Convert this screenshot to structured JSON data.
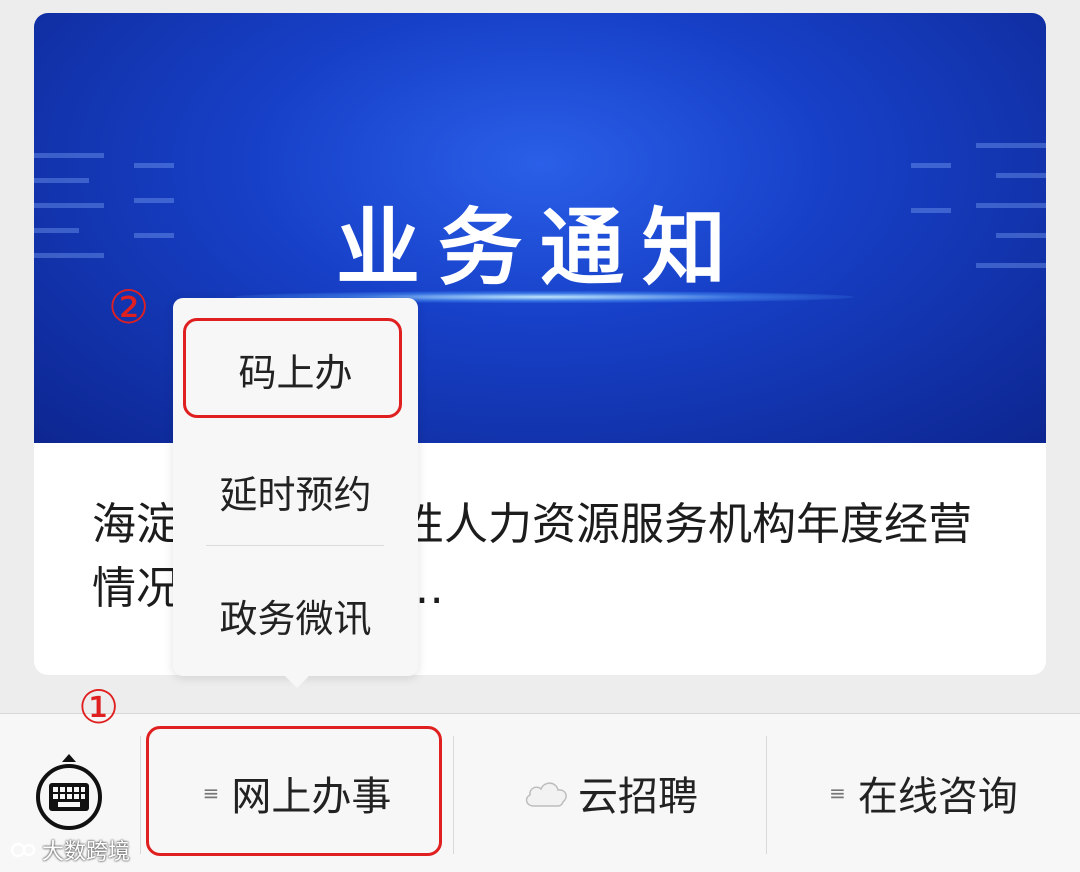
{
  "article": {
    "banner_title": "业务通知",
    "title": "海淀区开展经营性人力资源服务机构年度经营情况年度报告工…"
  },
  "popup_menu": {
    "items": [
      {
        "label": "码上办"
      },
      {
        "label": "延时预约"
      },
      {
        "label": "政务微讯"
      }
    ]
  },
  "menu_bar": {
    "items": [
      {
        "label": "网上办事",
        "icon": "menu-lines-icon"
      },
      {
        "label": "云招聘",
        "icon": "cloud-icon"
      },
      {
        "label": "在线咨询",
        "icon": "menu-lines-icon"
      }
    ],
    "menu_lines_glyph": "≡",
    "keyboard_icon": "keyboard-icon"
  },
  "annotations": {
    "step1": "①",
    "step2": "②",
    "color": "#e02020"
  },
  "watermark": {
    "text": "大数跨境"
  },
  "colors": {
    "banner_blue": "#1740c8",
    "menu_bar_bg": "#f7f7f7",
    "page_bg": "#ededed"
  }
}
